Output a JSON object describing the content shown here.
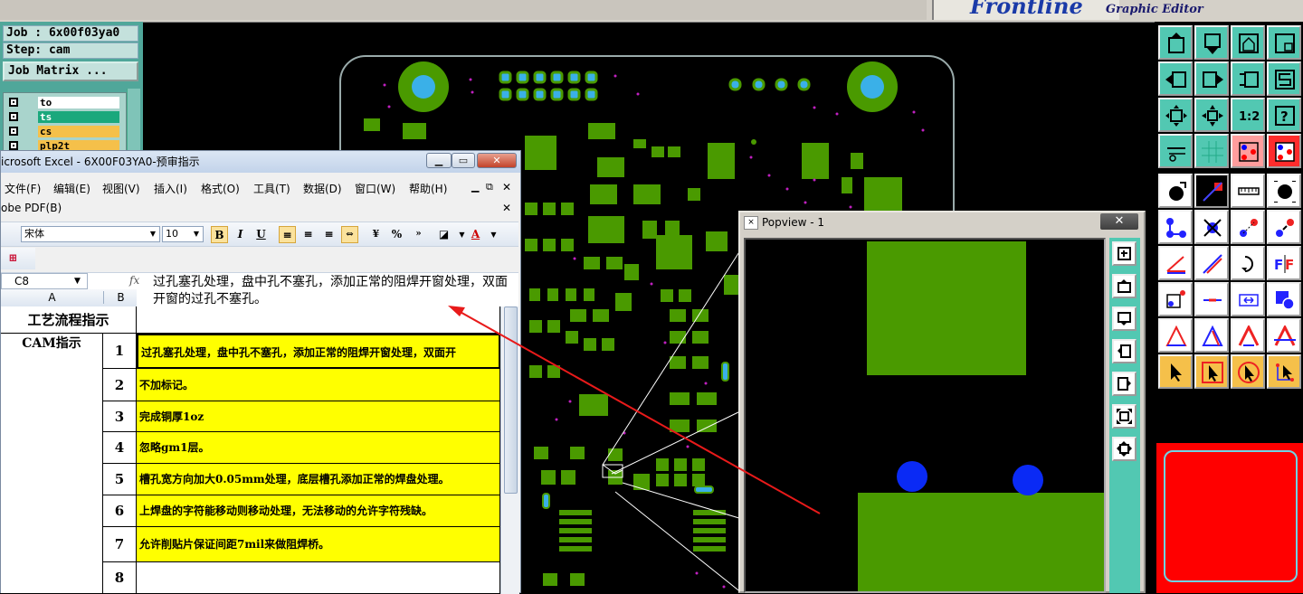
{
  "topbar": {
    "brand": "Frontline",
    "subtitle": "Graphic Editor"
  },
  "job": {
    "job_label": "Job : 6x00f03ya0",
    "step_label": "Step: cam",
    "matrix_button": "Job Matrix ...",
    "layers": [
      {
        "name": "to",
        "color": "#ffffff"
      },
      {
        "name": "ts",
        "color": "#1aa87c"
      },
      {
        "name": "cs",
        "color": "#f5c04a"
      },
      {
        "name": "plp2t",
        "color": "#f5c04a"
      }
    ]
  },
  "excel": {
    "title": "icrosoft Excel - 6X00F03YA0-预审指示",
    "menus": [
      "文件(F)",
      "编辑(E)",
      "视图(V)",
      "插入(I)",
      "格式(O)",
      "工具(T)",
      "数据(D)",
      "窗口(W)",
      "帮助(H)"
    ],
    "pdf_menu": "obe PDF(B)",
    "font_name": "宋体",
    "font_size": "10",
    "name_box": "C8",
    "fx": "fx",
    "formula": "过孔塞孔处理，盘中孔不塞孔，添加正常的阻焊开窗处理，双面开窗的过孔不塞孔。",
    "col_a": "A",
    "col_b": "B",
    "header": "工艺流程指示",
    "group_label": "CAM指示",
    "rows": [
      {
        "num": "1",
        "text": "过孔塞孔处理，盘中孔不塞孔，添加正常的阻焊开窗处理，双面开"
      },
      {
        "num": "2",
        "text": "不加标记。"
      },
      {
        "num": "3",
        "text": "完成铜厚1oz"
      },
      {
        "num": "4",
        "text": "忽略gm1层。"
      },
      {
        "num": "5",
        "text": "槽孔宽方向加大0.05mm处理，底层槽孔添加正常的焊盘处理。"
      },
      {
        "num": "6",
        "text": "上焊盘的字符能移动则移动处理，无法移动的允许字符残缺。"
      },
      {
        "num": "7",
        "text": "允许削贴片保证间距7mil来做阻焊桥。"
      },
      {
        "num": "8",
        "text": ""
      }
    ]
  },
  "popview": {
    "title": "Popview - 1",
    "close": "✕"
  },
  "colors": {
    "pad_green": "#4a9a00",
    "via_blue": "#0a2af5",
    "teal": "#52c8b2",
    "highlight": "#ffff00"
  }
}
